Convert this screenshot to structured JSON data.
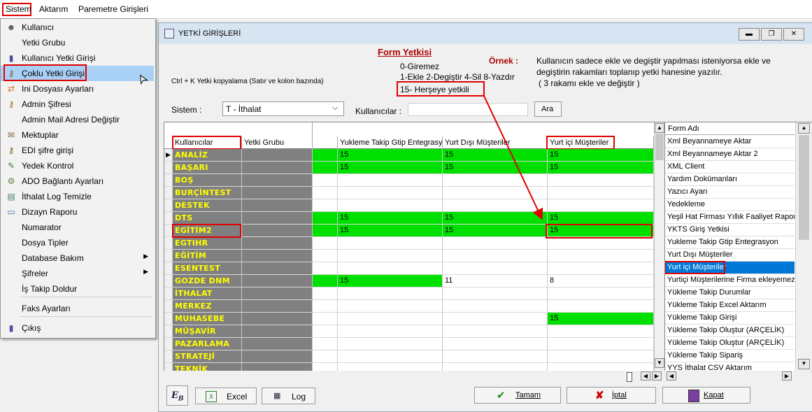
{
  "menubar": {
    "items": [
      "Sistem",
      "Aktarım",
      "Paremetre Girişleri"
    ]
  },
  "dropdown": {
    "items": [
      {
        "label": "Kullanıcı",
        "icon": "user-icon"
      },
      {
        "label": "Yetki Grubu",
        "icon": ""
      },
      {
        "label": "Kullanıcı Yetki Girişi",
        "icon": "user-key-icon"
      },
      {
        "label": "Çoklu Yetki Girişi",
        "icon": "multi-key-icon"
      },
      {
        "label": "Ini Dosyası  Ayarları",
        "icon": "ini-icon"
      },
      {
        "label": "Admin Şifresi",
        "icon": "key-icon"
      },
      {
        "label": "Admin Mail Adresi Değiştir",
        "icon": ""
      },
      {
        "label": "Mektuplar",
        "icon": "mail-icon"
      },
      {
        "label": "EDI şifre girişi",
        "icon": "edi-key-icon"
      },
      {
        "label": "Yedek Kontrol",
        "icon": "backup-icon"
      },
      {
        "label": "ADO Bağlantı Ayarları",
        "icon": "ado-icon"
      },
      {
        "label": "İthalat Log Temizle",
        "icon": "log-icon"
      },
      {
        "label": "Dizayn Raporu",
        "icon": "report-icon"
      },
      {
        "label": "Numarator",
        "icon": ""
      },
      {
        "label": "Dosya Tipler",
        "icon": ""
      },
      {
        "label": "Database Bakım",
        "icon": ""
      },
      {
        "label": "Şifreler",
        "icon": ""
      },
      {
        "label": "İş Takip Doldur",
        "icon": ""
      },
      {
        "label": "Faks Ayarları",
        "icon": ""
      },
      {
        "label": "Çıkış",
        "icon": "exit-icon"
      }
    ]
  },
  "window": {
    "title": "YETKİ GİRİŞLERİ",
    "buttons": [
      "▬",
      "❐",
      "✕"
    ],
    "form_yetkisi_title": "Form Yetkisi",
    "legend_0": "0-Giremez",
    "legend_1": "1-Ekle  2-Degiştir  4-Sil  8-Yazdır",
    "legend_15": "15- Herşeye yetkili",
    "ornek_label": "Örnek :",
    "ornek_text_1": "Kullanıcın sadece ekle ve degiştir yapılması isteniyorsa  ekle ve",
    "ornek_text_2": "degiştirin rakamları toplanıp yetki hanesine yazılır.",
    "ornek_text_3": "( 3 rakamı ekle ve değiştir )",
    "copy_hint": "Ctrl + K Yetki kopyalama (Satır ve kolon bazında)",
    "sistem_label": "Sistem :",
    "sistem_value": "T - İthalat",
    "kullanicilar_label": "Kullanıcılar :",
    "ara_button": "Ara"
  },
  "grid": {
    "headers": [
      "Kullanıcılar",
      "Yetki Grubu",
      "Yukleme Takip Gtip Entegrasyon",
      "Yurt Dışı Müşteriler",
      "Yurt içi Müşteriler"
    ],
    "rows": [
      {
        "user": "ANALİZ",
        "green": true,
        "v": [
          "15",
          "15",
          "15"
        ]
      },
      {
        "user": "BAŞARI",
        "green": true,
        "v": [
          "15",
          "15",
          "15"
        ]
      },
      {
        "user": "BOŞ",
        "green": false,
        "v": [
          "",
          "",
          ""
        ]
      },
      {
        "user": "BURÇİNTEST",
        "green": false,
        "v": [
          "",
          "",
          ""
        ]
      },
      {
        "user": "DESTEK",
        "green": false,
        "v": [
          "",
          "",
          ""
        ]
      },
      {
        "user": "DTS",
        "green": true,
        "v": [
          "15",
          "15",
          "15"
        ]
      },
      {
        "user": "EGİTİM2",
        "green": true,
        "v": [
          "15",
          "15",
          "15"
        ]
      },
      {
        "user": "EGTIHR",
        "green": false,
        "v": [
          "",
          "",
          ""
        ]
      },
      {
        "user": "EĞİTİM",
        "green": false,
        "v": [
          "",
          "",
          ""
        ]
      },
      {
        "user": "ESENTEST",
        "green": false,
        "v": [
          "",
          "",
          ""
        ]
      },
      {
        "user": "GOZDE DNM",
        "green": "partial",
        "v": [
          "15",
          "11",
          "8"
        ]
      },
      {
        "user": "İTHALAT",
        "green": false,
        "v": [
          "",
          "",
          ""
        ]
      },
      {
        "user": "MERKEZ",
        "green": false,
        "v": [
          "",
          "",
          ""
        ]
      },
      {
        "user": "MUHASEBE",
        "green": "last",
        "v": [
          "",
          "",
          "15"
        ]
      },
      {
        "user": "MÜŞAVİR",
        "green": false,
        "v": [
          "",
          "",
          ""
        ]
      },
      {
        "user": "PAZARLAMA",
        "green": false,
        "v": [
          "",
          "",
          ""
        ]
      },
      {
        "user": "STRATEJİ",
        "green": false,
        "v": [
          "",
          "",
          ""
        ]
      },
      {
        "user": "TEKNİK",
        "green": false,
        "v": [
          "",
          "",
          ""
        ]
      }
    ]
  },
  "forms": {
    "header": "Form Adı",
    "items": [
      "Xml Beyannameye Aktar",
      "Xml Beyannameye Aktar 2",
      "XML Client",
      "Yardım Dokümanları",
      "Yazıcı Ayarı",
      "Yedekleme",
      "Yeşil Hat Firması Yıllık Faaliyet Raporu",
      "YKTS Giriş Yetkisi",
      "Yukleme Takip Gtip Entegrasyon",
      "Yurt Dışı Müşteriler",
      "Yurt içi Müşteriler",
      "Yurtiçi Müşterilerine Firma ekleyemez",
      "Yükleme Takip Durumlar",
      "Yükleme Takip Excel Aktarım",
      "Yükleme Takip Girişi",
      "Yükleme Takip Oluştur (ARÇELİK)",
      "Yükleme Takip Oluştur (ARÇELİK)",
      "Yükleme Takip Sipariş",
      "YYS İthalat CSV Aktarım"
    ],
    "selected_index": 10
  },
  "bottom": {
    "excel": "Excel",
    "log": "Log",
    "tamam": "Tamam",
    "iptal": "İptal",
    "kapat": "Kapat"
  },
  "colors": {
    "highlight_red": "#e00000",
    "grid_green": "#00e000",
    "user_text": "#ffff00",
    "user_bg": "#808080",
    "selection": "#0078d7"
  }
}
